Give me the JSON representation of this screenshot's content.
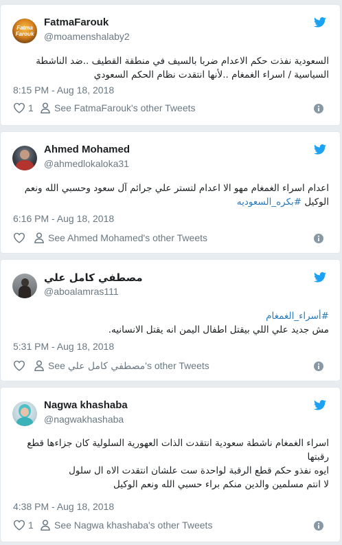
{
  "colors": {
    "accent": "#1da1f2",
    "link": "#2b7bb9",
    "muted": "#697882",
    "background": "#e9ecef"
  },
  "tweets": [
    {
      "name": "FatmaFarouk",
      "handle": "@moamenshalaby2",
      "avatar_text": "Fatma Farouk",
      "text": "السعودية نفذت حكم الاعدام ضربا بالسيف في منطقة القطيف ..ضد الناشطة السياسية / اسراء الغمغام ..لأنها انتقدت نظام الحكم السعودي",
      "time": "8:15 PM - Aug 18, 2018",
      "likes": "1",
      "other_tweets": "See FatmaFarouk's other Tweets"
    },
    {
      "name": "Ahmed Mohamed",
      "handle": "@ahmedlokaloka31",
      "text": "اعدام اسراء الغمغام مهو الا اعدام لتستر علي جرائم آل سعود وحسبي الله ونعم الوكيل",
      "hashtag": "#بكره_السعوديه",
      "time": "6:16 PM - Aug 18, 2018",
      "other_tweets": "See Ahmed Mohamed's other Tweets"
    },
    {
      "name": "مصطفي كامل علي",
      "handle": "@aboalamras111",
      "hashtag": "#أسراء_الغمغام",
      "text": "مش جديد علي اللي بيقتل اطفال اليمن انه يقتل الانسانيه.",
      "time": "5:31 PM - Aug 18, 2018",
      "other_see": "See",
      "other_name": "مصطفي كامل علي",
      "other_suffix": "'s other Tweets"
    },
    {
      "name": "Nagwa khashaba",
      "handle": "@nagwakhashaba",
      "text_lines": [
        "اسراء الغمغام ناشطة سعودية انتقدت الذات العهورية السلولية كان جزاءها قطع رقبتها",
        "ايوه نفذو حكم قطع الرقبة لواحدة ست علشان انتقدت الاه ال سلول",
        "لا انتم مسلمين والدين منكم براء حسبي الله ونعم الوكيل"
      ],
      "time": "4:38 PM - Aug 18, 2018",
      "likes": "1",
      "other_tweets": "See Nagwa khashaba's other Tweets"
    }
  ]
}
